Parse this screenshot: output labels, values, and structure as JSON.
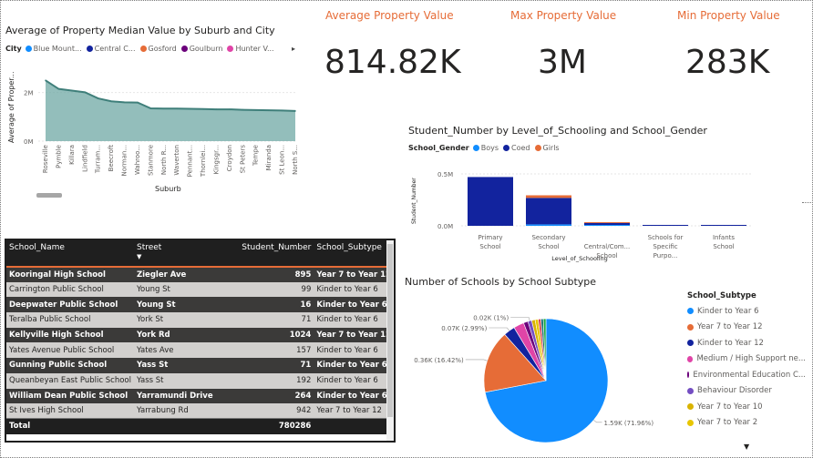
{
  "kpis": {
    "avg": {
      "label": "Average Property Value",
      "value": "814.82K"
    },
    "max": {
      "label": "Max Property Value",
      "value": "3M"
    },
    "min": {
      "label": "Min Property Value",
      "value": "283K"
    }
  },
  "area_chart": {
    "title": "Average of Property Median Value by Suburb and City",
    "legend_title": "City",
    "legend": [
      {
        "label": "Blue Mount...",
        "color": "#118dff"
      },
      {
        "label": "Central C...",
        "color": "#12239e"
      },
      {
        "label": "Gosford",
        "color": "#e66c37"
      },
      {
        "label": "Goulburn",
        "color": "#6b007b"
      },
      {
        "label": "Hunter V...",
        "color": "#e044a7"
      }
    ],
    "legend_more": "▸"
  },
  "bar_chart": {
    "title": "Student_Number by Level_of_Schooling and School_Gender",
    "legend_title": "School_Gender",
    "legend": [
      {
        "label": "Boys",
        "color": "#118dff"
      },
      {
        "label": "Coed",
        "color": "#12239e"
      },
      {
        "label": "Girls",
        "color": "#e66c37"
      }
    ]
  },
  "table": {
    "headers": [
      "School_Name",
      "Street",
      "Student_Number",
      "School_Subtype"
    ],
    "sort_indicator": "▼",
    "rows": [
      {
        "name": "Kooringal High School",
        "street": "Ziegler Ave",
        "num": "895",
        "subtype": "Year 7 to Year 12"
      },
      {
        "name": "Carrington Public School",
        "street": "Young St",
        "num": "99",
        "subtype": "Kinder to Year 6"
      },
      {
        "name": "Deepwater Public School",
        "street": "Young St",
        "num": "16",
        "subtype": "Kinder to Year 6"
      },
      {
        "name": "Teralba Public School",
        "street": "York St",
        "num": "71",
        "subtype": "Kinder to Year 6"
      },
      {
        "name": "Kellyville High School",
        "street": "York Rd",
        "num": "1024",
        "subtype": "Year 7 to Year 12"
      },
      {
        "name": "Yates Avenue Public School",
        "street": "Yates Ave",
        "num": "157",
        "subtype": "Kinder to Year 6"
      },
      {
        "name": "Gunning Public School",
        "street": "Yass St",
        "num": "71",
        "subtype": "Kinder to Year 6"
      },
      {
        "name": "Queanbeyan East Public School",
        "street": "Yass St",
        "num": "192",
        "subtype": "Kinder to Year 6"
      },
      {
        "name": "William Dean Public School",
        "street": "Yarramundi Drive",
        "num": "264",
        "subtype": "Kinder to Year 6"
      },
      {
        "name": "St Ives High School",
        "street": "Yarrabung Rd",
        "num": "942",
        "subtype": "Year 7 to Year 12"
      }
    ],
    "total_label": "Total",
    "total_value": "780286"
  },
  "pie_chart": {
    "title": "Number of Schools by School Subtype",
    "legend_title": "School_Subtype"
  },
  "chart_data": [
    {
      "type": "area",
      "title": "Average of Property Median Value by Suburb and City",
      "xlabel": "Suburb",
      "ylabel": "Average of Proper...",
      "ytick_labels": [
        "0M",
        "2M"
      ],
      "ylim": [
        0,
        3000000
      ],
      "grid": true,
      "series_color": "#6fa8a4",
      "categories": [
        "Roseville",
        "Pymble",
        "Killara",
        "Lindfield",
        "Turram...",
        "Beecroft",
        "Norman...",
        "Wahroo...",
        "Stanmore",
        "North R...",
        "Waverton",
        "Pennant...",
        "Thornlei...",
        "Kingsgr...",
        "Croydon",
        "St Peters",
        "Tempe",
        "Miranda",
        "St Leon...",
        "North S..."
      ],
      "values": [
        2500000,
        2150000,
        2080000,
        2010000,
        1760000,
        1640000,
        1600000,
        1590000,
        1350000,
        1340000,
        1340000,
        1330000,
        1320000,
        1310000,
        1310000,
        1290000,
        1280000,
        1270000,
        1260000,
        1240000
      ]
    },
    {
      "type": "bar",
      "title": "Student_Number by Level_of_Schooling and School_Gender",
      "xlabel": "Level_of_Schooling",
      "ylabel": "Student_Number",
      "ytick_labels": [
        "0.0M",
        "0.5M"
      ],
      "ylim": [
        0,
        600000
      ],
      "grid": true,
      "categories": [
        "Primary School",
        "Secondary School",
        "Central/Com... School",
        "Schools for Specific Purpo...",
        "Infants School"
      ],
      "series": [
        {
          "name": "Boys",
          "color": "#118dff",
          "values": [
            0,
            14000,
            2000,
            0,
            0
          ]
        },
        {
          "name": "Coed",
          "color": "#12239e",
          "values": [
            470000,
            255000,
            18000,
            5000,
            1000
          ]
        },
        {
          "name": "Girls",
          "color": "#e66c37",
          "values": [
            0,
            25000,
            1000,
            0,
            0
          ]
        }
      ]
    },
    {
      "type": "pie",
      "title": "Number of Schools by School Subtype",
      "slices": [
        {
          "label": "Kinder to Year 6",
          "value": 1590,
          "percent": 71.96,
          "color": "#118dff",
          "data_label": "1.59K (71.96%)"
        },
        {
          "label": "Year 7 to Year 12",
          "value": 363,
          "percent": 16.42,
          "color": "#e66c37",
          "data_label": "0.36K (16.42%)"
        },
        {
          "label": "Kinder to Year 12",
          "value": 66,
          "percent": 2.99,
          "color": "#12239e",
          "data_label": "0.07K (2.99%)"
        },
        {
          "label": "Medium / High Support ne...",
          "value": 60,
          "percent": 2.7,
          "color": "#e044a7",
          "data_label": ""
        },
        {
          "label": "Environmental Education C...",
          "value": 26,
          "percent": 1.2,
          "color": "#6b007b",
          "data_label": ""
        },
        {
          "label": "Behaviour Disorder",
          "value": 22,
          "percent": 1.0,
          "color": "#744ec2",
          "data_label": "0.02K (1%)"
        },
        {
          "label": "Year 7 to Year 10",
          "value": 20,
          "percent": 0.9,
          "color": "#d9b300",
          "data_label": ""
        },
        {
          "label": "Year 7 to Year 2",
          "value": 18,
          "percent": 0.8,
          "color": "#e8c600",
          "data_label": ""
        },
        {
          "label": "",
          "value": 15,
          "percent": 0.7,
          "color": "#d64550",
          "data_label": ""
        },
        {
          "label": "",
          "value": 14,
          "percent": 0.63,
          "color": "#197278",
          "data_label": ""
        },
        {
          "label": "",
          "value": 15,
          "percent": 0.7,
          "color": "#1aab40",
          "data_label": ""
        }
      ]
    }
  ]
}
